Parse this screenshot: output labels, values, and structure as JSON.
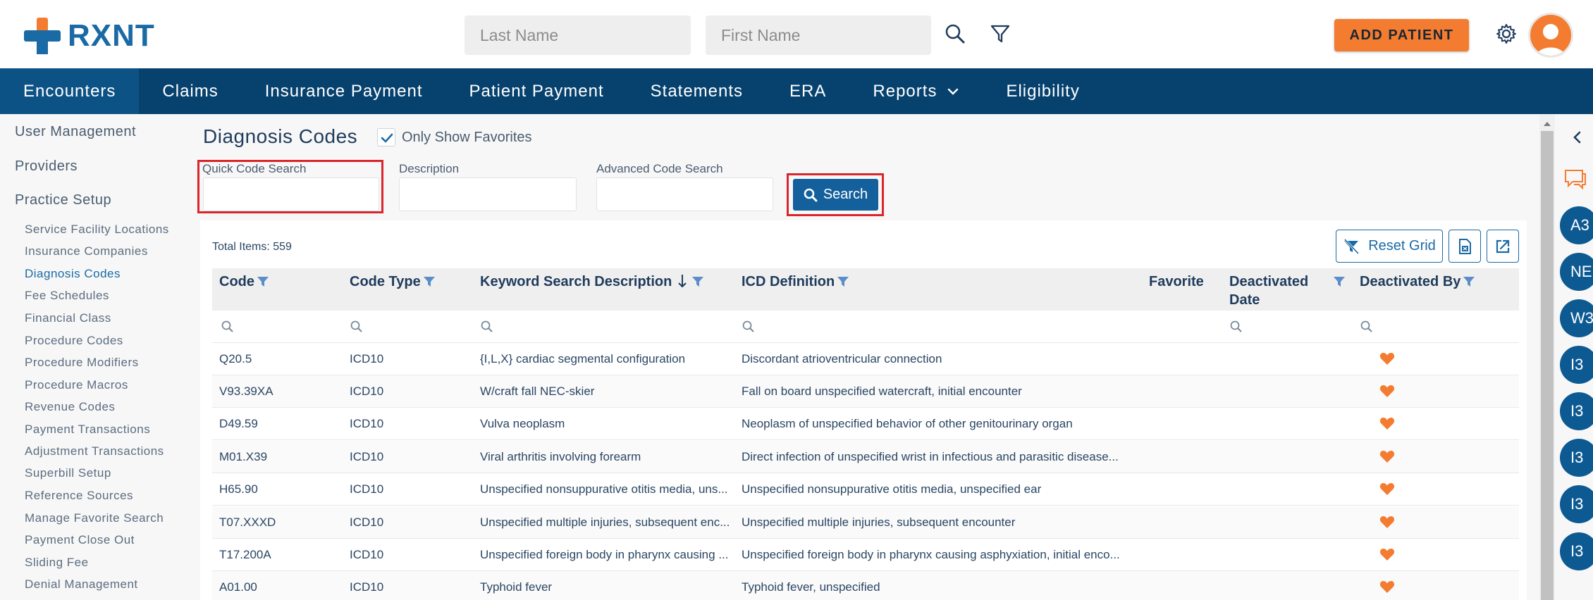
{
  "header": {
    "logo_text": "RXNT",
    "last_name_placeholder": "Last Name",
    "first_name_placeholder": "First Name",
    "add_patient_label": "ADD PATIENT"
  },
  "nav": {
    "items": [
      "Encounters",
      "Claims",
      "Insurance Payment",
      "Patient Payment",
      "Statements",
      "ERA",
      "Reports",
      "Eligibility"
    ],
    "active": "Encounters"
  },
  "sidebar": {
    "headings": [
      "User Management",
      "Providers",
      "Practice Setup"
    ],
    "items": [
      "Service Facility Locations",
      "Insurance Companies",
      "Diagnosis Codes",
      "Fee Schedules",
      "Financial Class",
      "Procedure Codes",
      "Procedure Modifiers",
      "Procedure Macros",
      "Revenue Codes",
      "Payment Transactions",
      "Adjustment Transactions",
      "Superbill Setup",
      "Reference Sources",
      "Manage Favorite Search",
      "Payment Close Out",
      "Sliding Fee",
      "Denial Management"
    ],
    "active_item": "Diagnosis Codes"
  },
  "page": {
    "title": "Diagnosis Codes",
    "only_favorites_label": "Only Show Favorites",
    "only_favorites_checked": true,
    "quick_code_label": "Quick Code Search",
    "description_label": "Description",
    "advanced_code_label": "Advanced Code Search",
    "search_button": "Search",
    "total_items": "Total Items: 559",
    "reset_grid": "Reset Grid"
  },
  "table": {
    "columns": [
      "Code",
      "Code Type",
      "Keyword Search Description",
      "ICD Definition",
      "Favorite",
      "Deactivated Date",
      "Deactivated By"
    ],
    "deactivated_date_lines": [
      "Deactivated",
      "Date"
    ],
    "rows": [
      {
        "code": "Q20.5",
        "type": "ICD10",
        "desc": "{I,L,X} cardiac segmental configuration",
        "icd": "Discordant atrioventricular connection",
        "favorite": true
      },
      {
        "code": "V93.39XA",
        "type": "ICD10",
        "desc": "W/craft fall NEC-skier",
        "icd": "Fall on board unspecified watercraft, initial encounter",
        "favorite": true
      },
      {
        "code": "D49.59",
        "type": "ICD10",
        "desc": "Vulva neoplasm",
        "icd": "Neoplasm of unspecified behavior of other genitourinary organ",
        "favorite": true
      },
      {
        "code": "M01.X39",
        "type": "ICD10",
        "desc": "Viral arthritis involving forearm",
        "icd": "Direct infection of unspecified wrist in infectious and parasitic disease...",
        "favorite": true
      },
      {
        "code": "H65.90",
        "type": "ICD10",
        "desc": "Unspecified nonsuppurative otitis media, uns...",
        "icd": "Unspecified nonsuppurative otitis media, unspecified ear",
        "favorite": true
      },
      {
        "code": "T07.XXXD",
        "type": "ICD10",
        "desc": "Unspecified multiple injuries, subsequent enc...",
        "icd": "Unspecified multiple injuries, subsequent encounter",
        "favorite": true
      },
      {
        "code": "T17.200A",
        "type": "ICD10",
        "desc": "Unspecified foreign body in pharynx causing ...",
        "icd": "Unspecified foreign body in pharynx causing asphyxiation, initial enco...",
        "favorite": true
      },
      {
        "code": "A01.00",
        "type": "ICD10",
        "desc": "Typhoid fever",
        "icd": "Typhoid fever, unspecified",
        "favorite": true
      }
    ]
  },
  "rightbar": {
    "bubbles": [
      "A3",
      "NE",
      "W3",
      "I3",
      "I3",
      "I3",
      "I3",
      "I3"
    ]
  },
  "colors": {
    "brand_blue": "#1a6aa5",
    "nav_bg": "#07426f",
    "accent_orange": "#f47c30",
    "highlight_red": "#d9262c"
  }
}
